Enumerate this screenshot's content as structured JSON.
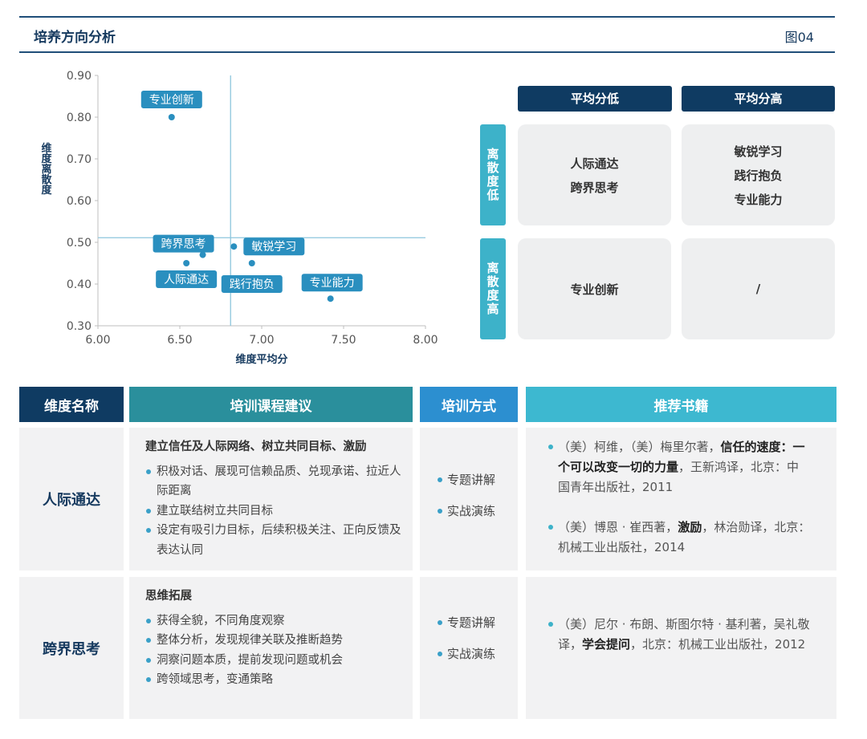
{
  "header": {
    "title": "培养方向分析",
    "figure_label": "图04"
  },
  "chart_data": {
    "type": "scatter",
    "xlabel": "维度平均分",
    "ylabel": "维度离散度",
    "xlim": [
      6.0,
      8.0
    ],
    "ylim": [
      0.3,
      0.9
    ],
    "x_ticks": [
      "6.00",
      "6.50",
      "7.00",
      "7.50",
      "8.00"
    ],
    "y_ticks": [
      "0.30",
      "0.40",
      "0.50",
      "0.60",
      "0.70",
      "0.80",
      "0.90"
    ],
    "reference_lines": {
      "x": 6.81,
      "y": 0.511
    },
    "points": [
      {
        "label": "专业创新",
        "x": 6.45,
        "y": 0.8
      },
      {
        "label": "跨界思考",
        "x": 6.64,
        "y": 0.47
      },
      {
        "label": "人际通达",
        "x": 6.54,
        "y": 0.45
      },
      {
        "label": "敏锐学习",
        "x": 6.83,
        "y": 0.49
      },
      {
        "label": "践行抱负",
        "x": 6.94,
        "y": 0.45
      },
      {
        "label": "专业能力",
        "x": 7.42,
        "y": 0.365
      }
    ],
    "colors": {
      "point": "#2a8fbf",
      "label_bg": "#2a8fbf",
      "reference": "#8dc6dd"
    }
  },
  "matrix": {
    "col_headers": [
      "平均分低",
      "平均分高"
    ],
    "row_headers": [
      "离散度低",
      "离散度高"
    ],
    "cells": [
      [
        [
          "人际通达",
          "跨界思考"
        ],
        [
          "敏锐学习",
          "践行抱负",
          "专业能力"
        ]
      ],
      [
        [
          "专业创新"
        ],
        [
          "/"
        ]
      ]
    ],
    "colors": {
      "col_header": "#0f3b62",
      "row_header": "#3db2c9"
    }
  },
  "table": {
    "headers": {
      "dimension": "维度名称",
      "course": "培训课程建议",
      "method": "培训方式",
      "books": "推荐书籍"
    },
    "rows": [
      {
        "dimension": "人际通达",
        "course_title": "建立信任及人际网络、树立共同目标、激励",
        "course_items": [
          "积极对话、展现可信赖品质、兑现承诺、拉近人际距离",
          "建立联结树立共同目标",
          "设定有吸引力目标，后续积极关注、正向反馈及表达认同"
        ],
        "methods": [
          "专题讲解",
          "实战演练"
        ],
        "books": [
          {
            "pre": "（美）柯维，（美）梅里尔著，",
            "title": "信任的速度：一个可以改变一切的力量",
            "post": "，王新鸿译，北京：中国青年出版社，2011"
          },
          {
            "pre": "（美）博恩 · 崔西著，",
            "title": "激励",
            "post": "，林治勋译，北京：机械工业出版社，2014"
          }
        ]
      },
      {
        "dimension": "跨界思考",
        "course_title": "思维拓展",
        "course_items": [
          "获得全貌，不同角度观察",
          "整体分析，发现规律关联及推断趋势",
          "洞察问题本质，提前发现问题或机会",
          "跨领域思考，变通策略"
        ],
        "methods": [
          "专题讲解",
          "实战演练"
        ],
        "books": [
          {
            "pre": "（美）尼尔 · 布朗、斯图尔特 · 基利著，吴礼敬译，",
            "title": "学会提问",
            "post": "，北京：机械工业出版社，2012"
          }
        ]
      }
    ],
    "colors": {
      "dimension": "#0f3b62",
      "course": "#2a8f9c",
      "method": "#2c8fd0",
      "books": "#3db8d0"
    }
  }
}
